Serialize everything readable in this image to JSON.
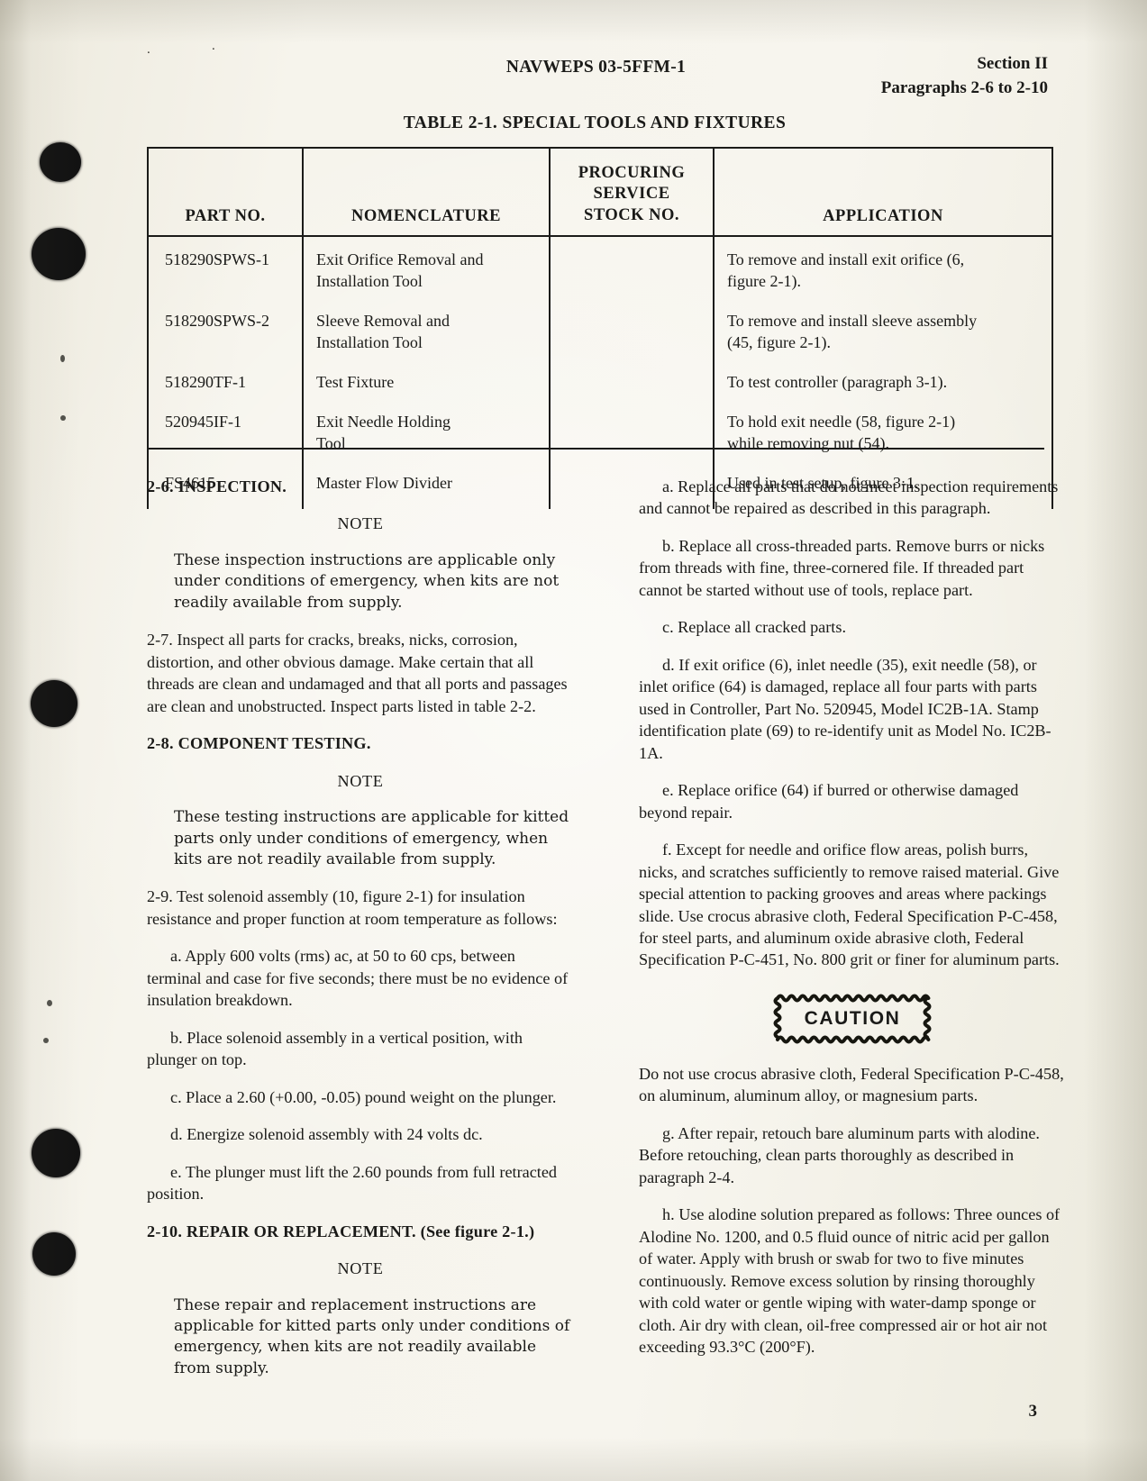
{
  "header": {
    "doc_number": "NAVWEPS 03-5FFM-1",
    "section": "Section II",
    "paragraphs_range": "Paragraphs 2-6 to 2-10"
  },
  "table": {
    "title": "TABLE 2-1.  SPECIAL TOOLS AND FIXTURES",
    "columns": [
      {
        "id": "part",
        "label": "PART NO."
      },
      {
        "id": "nomenclature",
        "label": "NOMENCLATURE"
      },
      {
        "id": "stock",
        "label_line1": "PROCURING",
        "label_line2": "SERVICE",
        "label_line3": "STOCK NO."
      },
      {
        "id": "application",
        "label": "APPLICATION"
      }
    ],
    "rows": [
      {
        "part": "518290SPWS-1",
        "nomenclature_line1": "Exit Orifice Removal and",
        "nomenclature_line2": "Installation Tool",
        "stock": "",
        "application_line1": "To remove and install exit orifice (6,",
        "application_line2": "figure 2-1)."
      },
      {
        "part": "518290SPWS-2",
        "nomenclature_line1": "Sleeve Removal and",
        "nomenclature_line2": "Installation Tool",
        "stock": "",
        "application_line1": "To remove and install sleeve assembly",
        "application_line2": "(45, figure 2-1)."
      },
      {
        "part": "518290TF-1",
        "nomenclature_line1": "Test Fixture",
        "nomenclature_line2": "",
        "stock": "",
        "application_line1": "To test controller (paragraph 3-1).",
        "application_line2": ""
      },
      {
        "part": "520945IF-1",
        "nomenclature_line1": "Exit Needle Holding",
        "nomenclature_line2": "Tool",
        "stock": "",
        "application_line1": "To hold exit needle (58, figure 2-1)",
        "application_line2": "while removing nut (54)."
      },
      {
        "part": "FS4615",
        "nomenclature_line1": "Master Flow Divider",
        "nomenclature_line2": "",
        "stock": "",
        "application_line1": "Used in test setup, figure 3-1.",
        "application_line2": ""
      }
    ]
  },
  "left_column": {
    "para_2_6_heading": "2-6.  INSPECTION.",
    "note_1_label": "NOTE",
    "note_1_body": "These inspection instructions are applicable only under conditions of emergency, when kits are not readily available from supply.",
    "para_2_7": "2-7.  Inspect all parts for cracks, breaks, nicks, corrosion, distortion, and other obvious damage.  Make certain that all threads are clean and undamaged and that all ports and passages are clean and unobstructed. Inspect parts listed in table 2-2.",
    "para_2_8_heading": "2-8.  COMPONENT TESTING.",
    "note_2_label": "NOTE",
    "note_2_body": "These testing instructions are applicable for kitted parts only under conditions of emergency, when kits are not readily available from supply.",
    "para_2_9": "2-9.  Test solenoid assembly (10, figure 2-1) for insulation resistance and proper function at room temperature as follows:",
    "item_a": "a.  Apply 600 volts (rms) ac, at 50 to 60 cps, between terminal and case for five seconds; there must be no evidence of insulation breakdown.",
    "item_b": "b.  Place solenoid assembly in a vertical position, with plunger on top.",
    "item_c": "c.  Place a 2.60 (+0.00, -0.05) pound weight on the plunger.",
    "item_d": "d.  Energize solenoid assembly with 24  volts dc.",
    "item_e": "e.  The plunger must lift the 2.60 pounds from full retracted position.",
    "para_2_10_heading": "2-10.  REPAIR OR REPLACEMENT.  (See figure 2-1.)",
    "note_3_label": "NOTE",
    "note_3_body": "These repair and replacement instructions are applicable for kitted parts only under conditions of emergency, when kits are not readily available from supply."
  },
  "right_column": {
    "item_a": "a.  Replace all parts that do not meet inspection requirements and cannot be repaired as described in this paragraph.",
    "item_b": "b.  Replace all cross-threaded parts.  Remove burrs or nicks from threads with fine, three-cornered file. If threaded part cannot be started without use of tools, replace part.",
    "item_c": "c.  Replace all cracked parts.",
    "item_d": "d.  If exit orifice (6), inlet needle (35), exit needle (58), or inlet orifice (64) is damaged, replace all four parts with parts used in Controller, Part No. 520945, Model IC2B-1A.  Stamp identification plate (69) to re-identify unit as Model No.  IC2B-1A.",
    "item_e": "e.  Replace orifice (64) if burred or otherwise damaged beyond repair.",
    "item_f": "f.  Except for needle and orifice flow areas, polish burrs, nicks, and scratches sufficiently to remove raised material.  Give special attention to packing grooves and areas where packings slide.  Use crocus abrasive cloth, Federal Specification P-C-458, for steel parts, and aluminum oxide abrasive cloth, Federal Specification P-C-451, No. 800 grit or finer for aluminum parts.",
    "caution_label": "CAUTION",
    "caution_body": "Do not use crocus abrasive cloth, Federal Specification P-C-458, on aluminum, aluminum alloy, or magnesium parts.",
    "item_g": "g.  After repair, retouch bare aluminum parts with alodine.  Before retouching, clean parts thoroughly as described in paragraph 2-4.",
    "item_h": "h.  Use alodine solution prepared as follows:  Three ounces of Alodine No. 1200, and 0.5 fluid ounce of nitric acid per gallon of water.  Apply with brush or swab for two to five minutes continuously.  Remove excess solution by rinsing thoroughly with cold water or gentle wiping with water-damp sponge or cloth. Air dry with clean, oil-free compressed air or hot air not exceeding 93.3°C (200°F)."
  },
  "footer": {
    "page_number": "3"
  }
}
